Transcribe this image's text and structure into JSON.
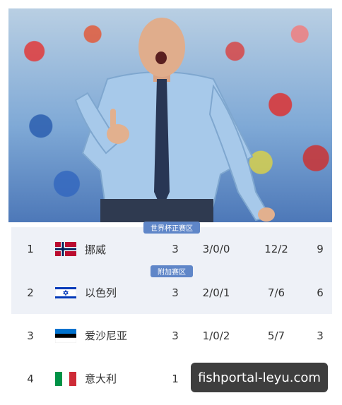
{
  "table": {
    "zones": {
      "world_cup": "世界杯正赛区",
      "playoff": "附加赛区"
    },
    "rows": [
      {
        "rank": "1",
        "flag": "norway-flag",
        "team": "挪威",
        "played": "3",
        "wdl": "3/0/0",
        "goals": "12/2",
        "points": "9"
      },
      {
        "rank": "2",
        "flag": "israel-flag",
        "team": "以色列",
        "played": "3",
        "wdl": "2/0/1",
        "goals": "7/6",
        "points": "6"
      },
      {
        "rank": "3",
        "flag": "estonia-flag",
        "team": "爱沙尼亚",
        "played": "3",
        "wdl": "1/0/2",
        "goals": "5/7",
        "points": "3"
      },
      {
        "rank": "4",
        "flag": "italy-flag",
        "team": "意大利",
        "played": "1",
        "wdl": "",
        "goals": "",
        "points": ""
      }
    ]
  },
  "watermark": {
    "text": "fishportal-leyu.com"
  },
  "colors": {
    "row_shade": "#eef1f7",
    "zone_badge": "#5f86c8"
  }
}
